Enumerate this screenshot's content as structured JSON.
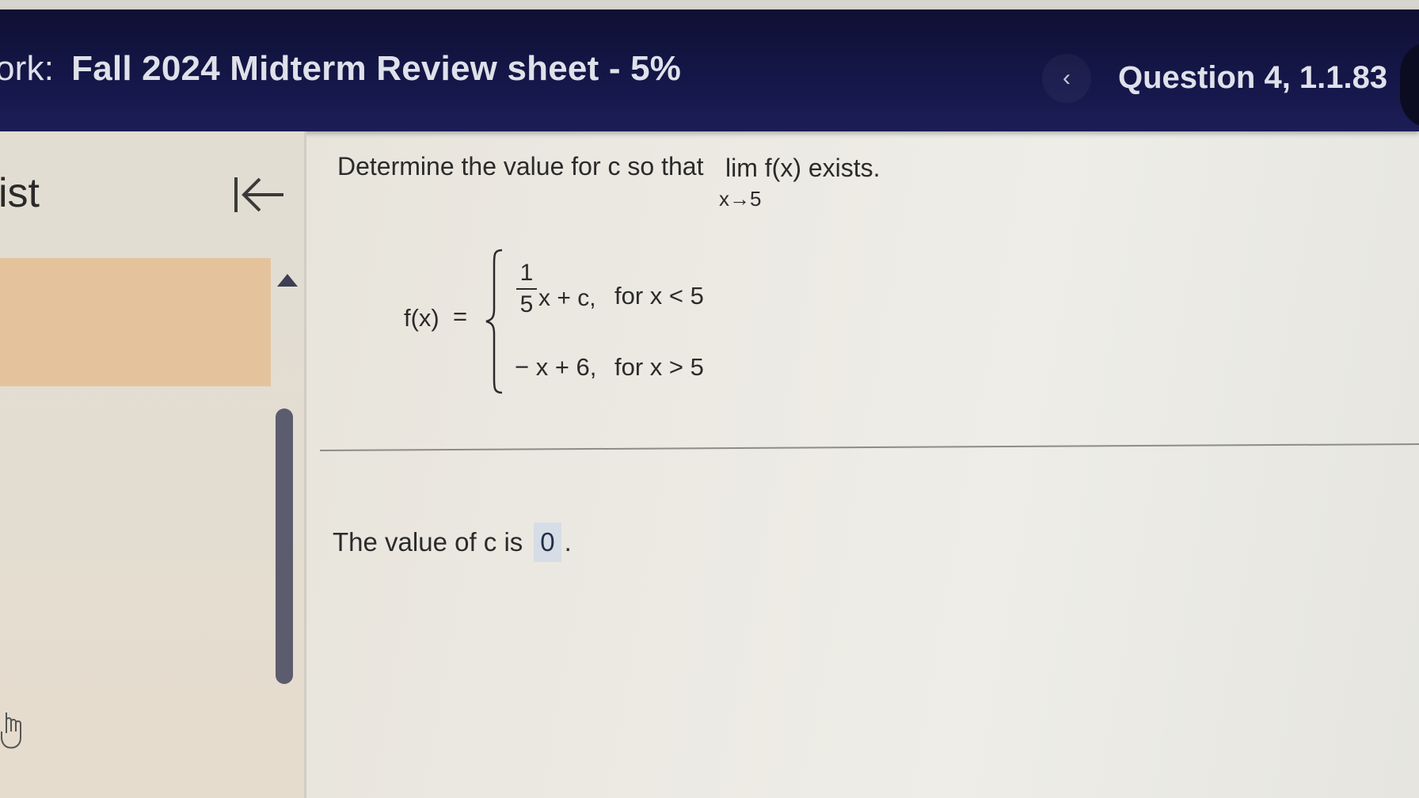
{
  "header": {
    "prefix": "ork:",
    "assignment_title": "Fall 2024 Midterm Review sheet - 5%",
    "prev_icon": "chevron-left-icon",
    "question_label": "Question 4, 1.1.83"
  },
  "sidebar": {
    "title": "ist",
    "collapse_icon": "collapse-left-icon",
    "scroll_up_icon": "triangle-up-icon"
  },
  "question": {
    "prompt": "Determine the value for c so that",
    "lim_word": "lim f(x) exists.",
    "lim_sub": "x→5",
    "function_label": "f(x)",
    "equals": "=",
    "case1": {
      "frac_num": "1",
      "frac_den": "5",
      "expr": "x + c,",
      "condition": "for x < 5"
    },
    "case2": {
      "expr": "− x + 6,",
      "condition": "for x > 5"
    }
  },
  "answer": {
    "text": "The value of c is",
    "value": "0",
    "period": "."
  },
  "colors": {
    "header_bg": "#15174a",
    "active_item": "#e4c39c",
    "answer_box": "#d6dde6"
  }
}
